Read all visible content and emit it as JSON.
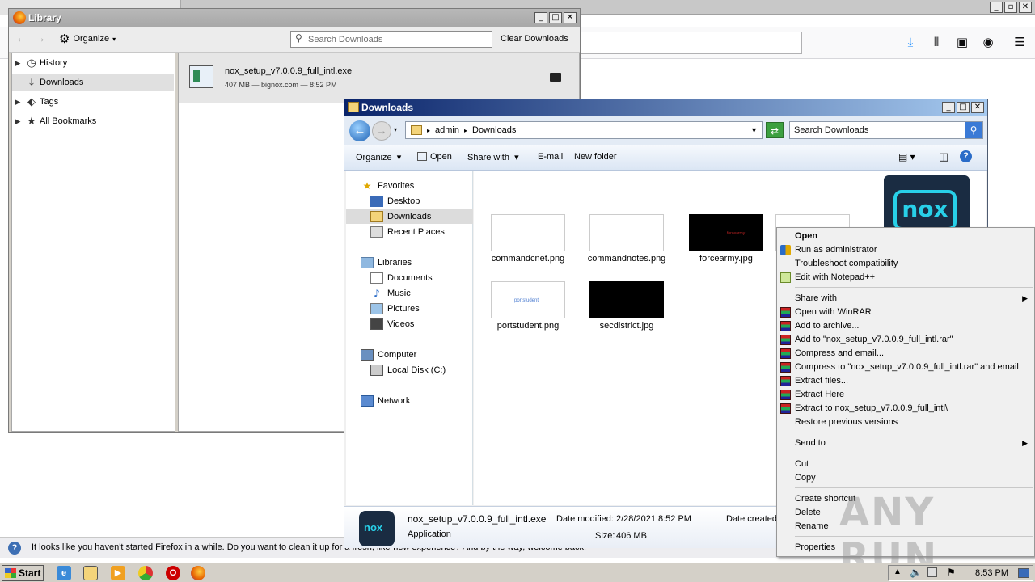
{
  "firefox": {
    "notification": "It looks like you haven't started Firefox in a while. Do you want to clean it up for a fresh, like-new experience? And by the way, welcome back!"
  },
  "library": {
    "title": "Library",
    "organize_label": "Organize",
    "search_placeholder": "Search Downloads",
    "clear_label": "Clear Downloads",
    "sidebar": [
      {
        "label": "History",
        "icon": "clock-icon",
        "expandable": true
      },
      {
        "label": "Downloads",
        "icon": "download-icon",
        "expandable": false,
        "selected": true
      },
      {
        "label": "Tags",
        "icon": "tag-icon",
        "expandable": true
      },
      {
        "label": "All Bookmarks",
        "icon": "star-icon",
        "expandable": true
      }
    ],
    "download": {
      "filename": "nox_setup_v7.0.0.9_full_intl.exe",
      "meta": "407 MB — bignox.com — 8:52 PM"
    }
  },
  "explorer": {
    "title": "Downloads",
    "breadcrumb": [
      "admin",
      "Downloads"
    ],
    "search_placeholder": "Search Downloads",
    "commands": {
      "organize": "Organize",
      "open": "Open",
      "share": "Share with",
      "email": "E-mail",
      "new_folder": "New folder"
    },
    "nav": {
      "favorites": "Favorites",
      "desktop": "Desktop",
      "downloads": "Downloads",
      "recent": "Recent Places",
      "libraries": "Libraries",
      "documents": "Documents",
      "music": "Music",
      "pictures": "Pictures",
      "videos": "Videos",
      "computer": "Computer",
      "local_disk": "Local Disk (C:)",
      "network": "Network"
    },
    "files": [
      {
        "name": "commandcnet.png",
        "bg": "#ffffff",
        "caption": ""
      },
      {
        "name": "commandnotes.png",
        "bg": "#ffffff",
        "caption": ""
      },
      {
        "name": "forcearmy.jpg",
        "bg": "#000000",
        "caption": "forcearmy"
      },
      {
        "name": "portstudent.png",
        "bg": "#ffffff",
        "caption": "portstudent"
      },
      {
        "name": "secdistrict.jpg",
        "bg": "#000000",
        "caption": ""
      }
    ],
    "details": {
      "filename": "nox_setup_v7.0.0.9_full_intl.exe",
      "type": "Application",
      "modified_label": "Date modified:",
      "modified_value": "2/28/2021 8:52 PM",
      "created_label": "Date created:",
      "size_label": "Size:",
      "size_value": "406 MB"
    }
  },
  "context_menu": {
    "open": "Open",
    "run_admin": "Run as administrator",
    "troubleshoot": "Troubleshoot compatibility",
    "notepad": "Edit with Notepad++",
    "share": "Share with",
    "open_winrar": "Open with WinRAR",
    "add_archive": "Add to archive...",
    "add_to_rar": "Add to \"nox_setup_v7.0.0.9_full_intl.rar\"",
    "compress_email": "Compress and email...",
    "compress_to_email": "Compress to \"nox_setup_v7.0.0.9_full_intl.rar\" and email",
    "extract_files": "Extract files...",
    "extract_here": "Extract Here",
    "extract_to": "Extract to nox_setup_v7.0.0.9_full_intl\\",
    "restore": "Restore previous versions",
    "send_to": "Send to",
    "cut": "Cut",
    "copy": "Copy",
    "create_shortcut": "Create shortcut",
    "delete": "Delete",
    "rename": "Rename",
    "properties": "Properties"
  },
  "watermark": "ANY RUN",
  "taskbar": {
    "start": "Start",
    "clock": "8:53 PM"
  }
}
